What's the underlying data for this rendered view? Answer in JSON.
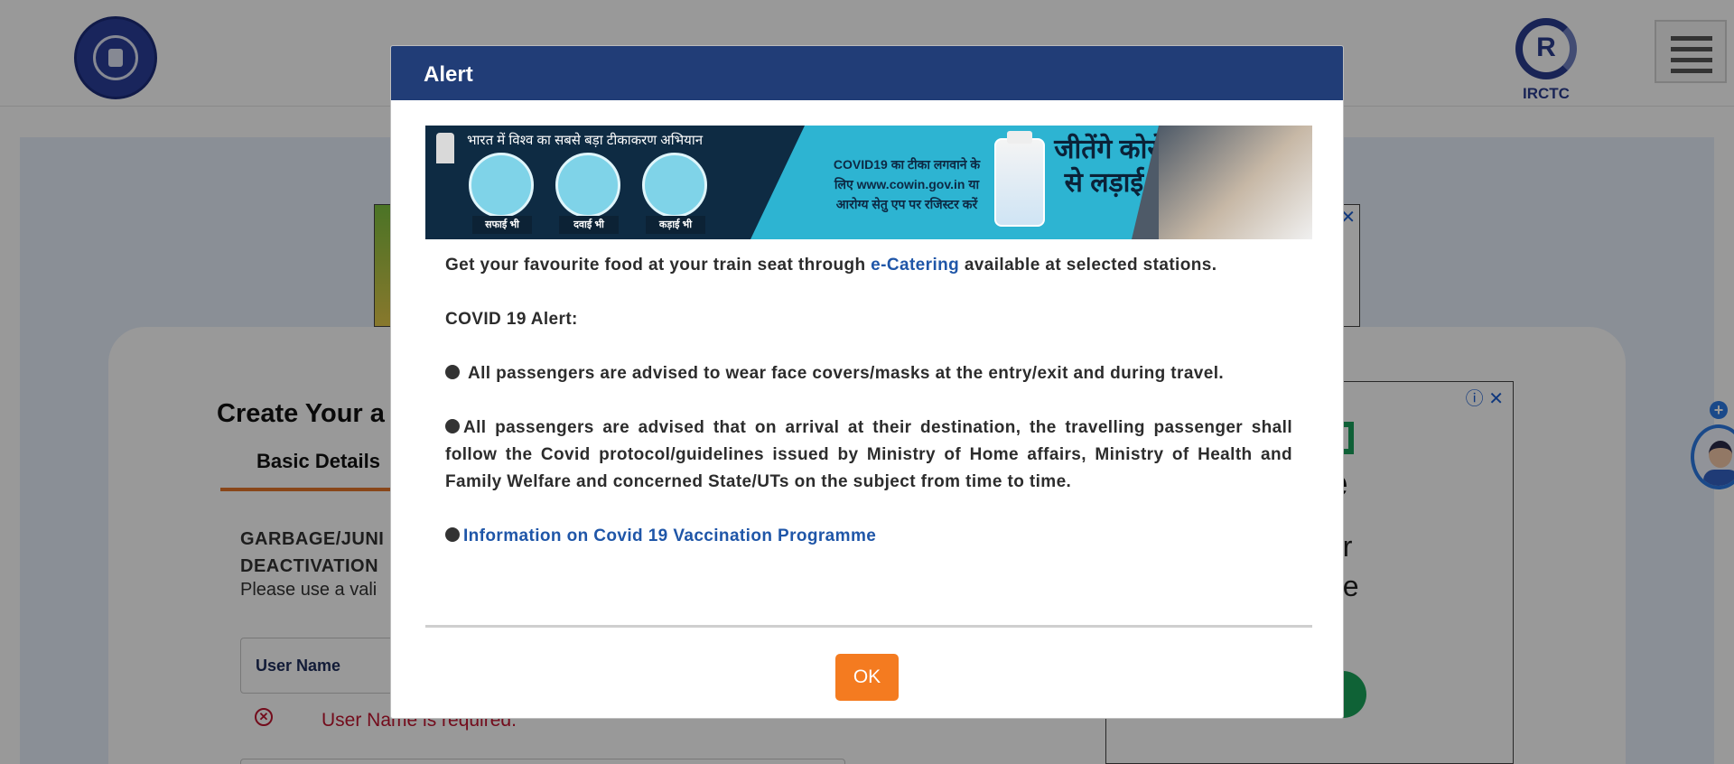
{
  "header": {
    "irctc_logo_text": "IRCTC"
  },
  "registration": {
    "title": "Create Your a",
    "tab_basic": "Basic Details",
    "garbage_line1": "GARBAGE/JUNI",
    "garbage_line2": "DEACTIVATION",
    "please_text": "Please use a vali",
    "username_label": "User Name",
    "username_error": "User Name is required."
  },
  "side_ad": {
    "big_text": "e",
    "line1": "ur",
    "line2": "ge"
  },
  "modal": {
    "title": "Alert",
    "banner": {
      "headline": "भारत में  विश्व का सबसे बड़ा  टीकाकरण अभियान",
      "caption1": "सफाई भी",
      "caption2": "दवाई भी",
      "caption3": "कड़ाई भी",
      "register_text": "COVID19 का टीका लगवाने के लिए www.cowin.gov.in या आरोग्य सेतु एप पर रजिस्टर करें",
      "slogan": "जीतेंगे कोरोना से लड़ाई भी"
    },
    "ecatering_pre": "Get your favourite food at your train seat through ",
    "ecatering_link": "e-Catering",
    "ecatering_post": " available at selected stations.",
    "covid_heading": "COVID 19 Alert:",
    "bullet1": "All passengers are advised to wear face covers/masks at the entry/exit and during travel.",
    "bullet2": "All passengers are advised that on arrival at their destination, the travelling passenger shall follow the Covid protocol/guidelines issued by Ministry of Home affairs, Ministry of Health and Family Welfare and concerned State/UTs on the subject from time to time.",
    "vaccination_link": "Information on Covid 19 Vaccination Programme",
    "ok_label": "OK"
  },
  "colors": {
    "modal_header": "#213d77",
    "ok_button": "#f47b20",
    "link": "#1f56a8",
    "error": "#c0152f"
  }
}
